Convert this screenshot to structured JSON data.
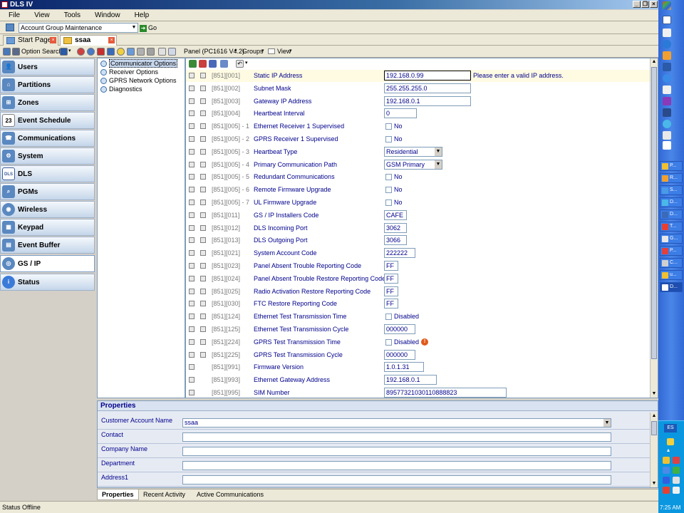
{
  "app": {
    "title": "DLS IV"
  },
  "menu": [
    "File",
    "View",
    "Tools",
    "Window",
    "Help"
  ],
  "address_bar": {
    "value": "Account Group Maintenance",
    "go_label": "Go"
  },
  "doc_tabs": [
    {
      "label": "Start Page"
    },
    {
      "label": "ssaa"
    }
  ],
  "toolbar": {
    "option_search": "Option Search",
    "panel": "Panel (PC1616 V4.2)",
    "groups": "Groups",
    "view": "View"
  },
  "sidebar": {
    "items": [
      {
        "label": "Users",
        "icon": "users-icon"
      },
      {
        "label": "Partitions",
        "icon": "house-icon"
      },
      {
        "label": "Zones",
        "icon": "zones-icon"
      },
      {
        "label": "Event Schedule",
        "icon": "calendar-icon"
      },
      {
        "label": "Communications",
        "icon": "phone-icon"
      },
      {
        "label": "System",
        "icon": "system-icon"
      },
      {
        "label": "DLS",
        "icon": "dls-icon"
      },
      {
        "label": "PGMs",
        "icon": "pgm-icon"
      },
      {
        "label": "Wireless",
        "icon": "wireless-icon"
      },
      {
        "label": "Keypad",
        "icon": "keypad-icon"
      },
      {
        "label": "Event Buffer",
        "icon": "buffer-icon"
      },
      {
        "label": "GS / IP",
        "icon": "gsip-icon"
      },
      {
        "label": "Status",
        "icon": "info-icon"
      }
    ],
    "selected": "GS / IP"
  },
  "tree": {
    "items": [
      "Communicator Options",
      "Receiver Options",
      "GPRS Network Options",
      "Diagnostics"
    ],
    "selected": "Communicator Options"
  },
  "grid": {
    "rows": [
      {
        "code": "[851][001]",
        "desc": "Static IP Address",
        "type": "text",
        "value": "192.168.0.99",
        "message": "Please enter a valid IP address."
      },
      {
        "code": "[851][002]",
        "desc": "Subnet Mask",
        "type": "text",
        "value": "255.255.255.0"
      },
      {
        "code": "[851][003]",
        "desc": "Gateway IP Address",
        "type": "text",
        "value": "192.168.0.1"
      },
      {
        "code": "[851][004]",
        "desc": "Heartbeat Interval",
        "type": "text",
        "value": "0"
      },
      {
        "code": "[851][005] - 1",
        "desc": "Ethernet Receiver 1 Supervised",
        "type": "check",
        "value": "No"
      },
      {
        "code": "[851][005] - 2",
        "desc": "GPRS Receiver 1 Supervised",
        "type": "check",
        "value": "No"
      },
      {
        "code": "[851][005] - 3",
        "desc": "Heartbeat Type",
        "type": "select",
        "value": "Residential"
      },
      {
        "code": "[851][005] - 4",
        "desc": "Primary Communication Path",
        "type": "select",
        "value": "GSM Primary"
      },
      {
        "code": "[851][005] - 5",
        "desc": "Redundant Communications",
        "type": "check",
        "value": "No"
      },
      {
        "code": "[851][005] - 6",
        "desc": "Remote Firmware Upgrade",
        "type": "check",
        "value": "No"
      },
      {
        "code": "[851][005] - 7",
        "desc": "UL Firmware Upgrade",
        "type": "check",
        "value": "No"
      },
      {
        "code": "[851][011]",
        "desc": "GS / IP Installers Code",
        "type": "text",
        "value": "CAFE"
      },
      {
        "code": "[851][012]",
        "desc": "DLS Incoming Port",
        "type": "text",
        "value": "3062"
      },
      {
        "code": "[851][013]",
        "desc": "DLS Outgoing Port",
        "type": "text",
        "value": "3066"
      },
      {
        "code": "[851][021]",
        "desc": "System Account Code",
        "type": "text",
        "value": "222222"
      },
      {
        "code": "[851][023]",
        "desc": "Panel Absent Trouble Reporting Code",
        "type": "text",
        "value": "FF"
      },
      {
        "code": "[851][024]",
        "desc": "Panel Absent Trouble Restore Reporting Code",
        "type": "text",
        "value": "FF"
      },
      {
        "code": "[851][025]",
        "desc": "Radio Activation Restore Reporting Code",
        "type": "text",
        "value": "FF"
      },
      {
        "code": "[851][030]",
        "desc": "FTC Restore Reporting Code",
        "type": "text",
        "value": "FF"
      },
      {
        "code": "[851][124]",
        "desc": "Ethernet Test Transmission Time",
        "type": "check",
        "value": "Disabled"
      },
      {
        "code": "[851][125]",
        "desc": "Ethernet Test Transmission Cycle",
        "type": "text",
        "value": "000000"
      },
      {
        "code": "[851][224]",
        "desc": "GPRS Test Transmission Time",
        "type": "check",
        "value": "Disabled",
        "warn": true
      },
      {
        "code": "[851][225]",
        "desc": "GPRS Test Transmission Cycle",
        "type": "text",
        "value": "000000"
      },
      {
        "code": "[851][991]",
        "desc": "Firmware Version",
        "type": "text",
        "value": "1.0.1.31"
      },
      {
        "code": "[851][993]",
        "desc": "Ethernet Gateway Address",
        "type": "text",
        "value": "192.168.0.1"
      },
      {
        "code": "[851][995]",
        "desc": "SIM Number",
        "type": "text",
        "value": "89577321030110888823"
      }
    ]
  },
  "properties": {
    "title": "Properties",
    "fields": [
      {
        "label": "Customer Account Name",
        "value": "ssaa",
        "dropdown": true
      },
      {
        "label": "Contact",
        "value": ""
      },
      {
        "label": "Company Name",
        "value": ""
      },
      {
        "label": "Department",
        "value": ""
      },
      {
        "label": "Address1",
        "value": ""
      }
    ],
    "tabs": [
      "Properties",
      "Recent Activity",
      "Active Communications"
    ],
    "active_tab": "Properties"
  },
  "status": {
    "label": "Status",
    "value": "Offline"
  },
  "taskbar": {
    "items": [
      "P...",
      "R...",
      "S...",
      "D...",
      "D...",
      "T...",
      "G...",
      "P...",
      "C...",
      "u...",
      "D..."
    ],
    "lang": "ES",
    "clock": "7:25 AM"
  },
  "colors": {
    "accent": "#0a246a",
    "label": "#00008b",
    "code": "#7a7a7a",
    "highlight_row": "#fffbe3",
    "taskbar": "#3168d5"
  }
}
